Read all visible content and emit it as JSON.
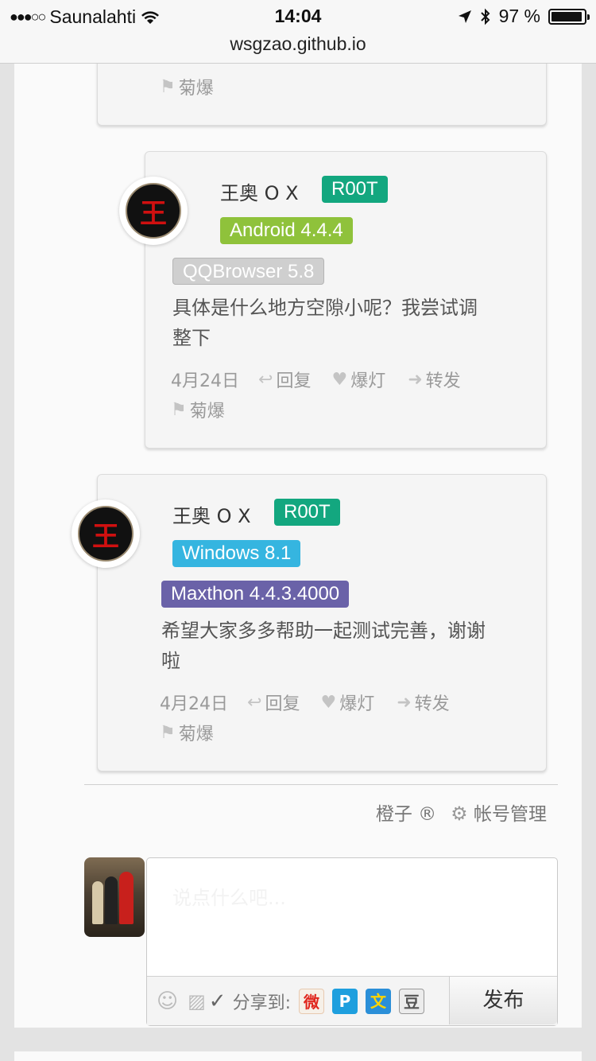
{
  "status": {
    "signal": "●●●○○",
    "carrier": "Saunalahti",
    "time": "14:04",
    "battery": "97 %",
    "battery_level": 0.97
  },
  "url": "wsgzao.github.io",
  "top_card": {
    "report": "菊爆"
  },
  "comments": [
    {
      "user": "王奥 O X",
      "badges": [
        "R00T",
        "Android 4.4.4",
        "QQBrowser 5.8"
      ],
      "text_lines": [
        "具体是什么地方空隙小呢？我尝试调",
        "整下"
      ],
      "date": "4月24日",
      "reply": "回复",
      "like": "爆灯",
      "forward": "转发",
      "report": "菊爆"
    },
    {
      "user": "王奥 O X",
      "badges": [
        "R00T",
        "Windows 8.1",
        "Maxthon 4.4.3.4000"
      ],
      "text_lines": [
        "希望大家多多帮助一起测试完善，谢谢",
        "啦"
      ],
      "date": "4月24日",
      "reply": "回复",
      "like": "爆灯",
      "forward": "转发",
      "report": "菊爆"
    }
  ],
  "account": {
    "user": "橙子 ®",
    "manage": "帐号管理"
  },
  "composer": {
    "placeholder": "说点什么吧...",
    "share_label": "分享到:",
    "publish": "发布"
  },
  "colors": {
    "root": "#13a77f",
    "android": "#8fc23b",
    "windows": "#35b5e0",
    "maxthon": "#6a62a8"
  }
}
